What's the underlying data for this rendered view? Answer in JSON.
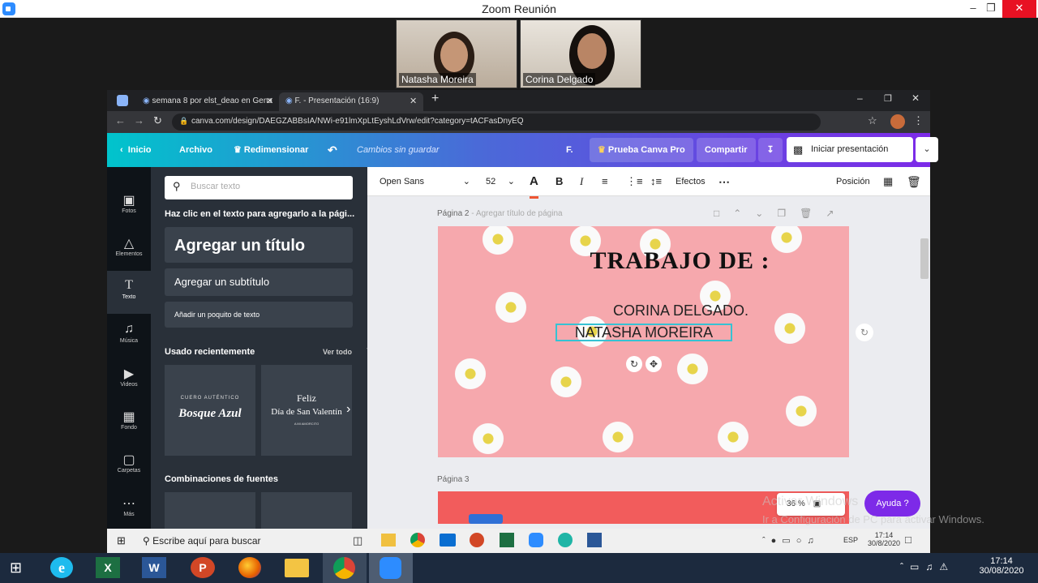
{
  "zoom": {
    "title": "Zoom Reunión"
  },
  "participants": [
    {
      "name": "Natasha Moreira"
    },
    {
      "name": "Corina Delgado"
    }
  ],
  "browser": {
    "tabs": [
      {
        "label": "semana 8 por elst_deao en Gena"
      },
      {
        "label": "F. - Presentación (16:9)"
      }
    ],
    "url": "canva.com/design/DAEGZABBsIA/NWi-e91lmXpLtEyshLdVrw/edit?category=tACFasDnyEQ"
  },
  "canva_header": {
    "home": "Inicio",
    "file": "Archivo",
    "resize": "Redimensionar",
    "status": "Cambios sin guardar",
    "title": "F.",
    "pro": "Prueba Canva Pro",
    "share": "Compartir",
    "present": "Iniciar presentación"
  },
  "rail": [
    {
      "label": "Fotos"
    },
    {
      "label": "Elementos"
    },
    {
      "label": "Texto"
    },
    {
      "label": "Música"
    },
    {
      "label": "Videos"
    },
    {
      "label": "Fondo"
    },
    {
      "label": "Carpetas"
    },
    {
      "label": "Más"
    }
  ],
  "panel": {
    "search_placeholder": "Buscar texto",
    "hint": "Haz clic en el texto para agregarlo a la pági...",
    "add_title": "Agregar un título",
    "add_subtitle": "Agregar un subtítulo",
    "add_body": "Añadir un poquito de texto",
    "recent": "Usado recientemente",
    "see_all": "Ver todo",
    "recent_items": [
      {
        "small": "CUERO AUTÉNTICO",
        "big": "Bosque Azul"
      },
      {
        "small": "Feliz",
        "big": "Día de San Valentín",
        "tiny": "A MI AMORCITO"
      }
    ],
    "combos": "Combinaciones de fuentes"
  },
  "toolbar": {
    "font": "Open Sans",
    "size": "52",
    "effects": "Efectos",
    "position": "Posición"
  },
  "canvas": {
    "page2_label": "Página 2",
    "page2_hint": " - Agregar título de página",
    "slide_title": "TRABAJO DE :",
    "line1": "CORINA DELGADO.",
    "line2": "NATASHA MOREIRA",
    "page3_label": "Página 3",
    "zoom": "36 %",
    "help": "Ayuda  ?"
  },
  "watermark": {
    "line1": "Activar Windows",
    "line2": "Ir a Configuración de PC para activar Windows."
  },
  "inner_taskbar": {
    "search": "Escribe aquí para buscar",
    "lang": "ESP",
    "time": "17:14",
    "date": "30/8/2020"
  },
  "outer_taskbar": {
    "time": "17:14",
    "date": "30/08/2020"
  },
  "colors": {
    "canva_teal": "#00c4cc",
    "canva_purple": "#7d2ae8",
    "slide_pink": "#f6a8ad",
    "panel": "#293039"
  }
}
